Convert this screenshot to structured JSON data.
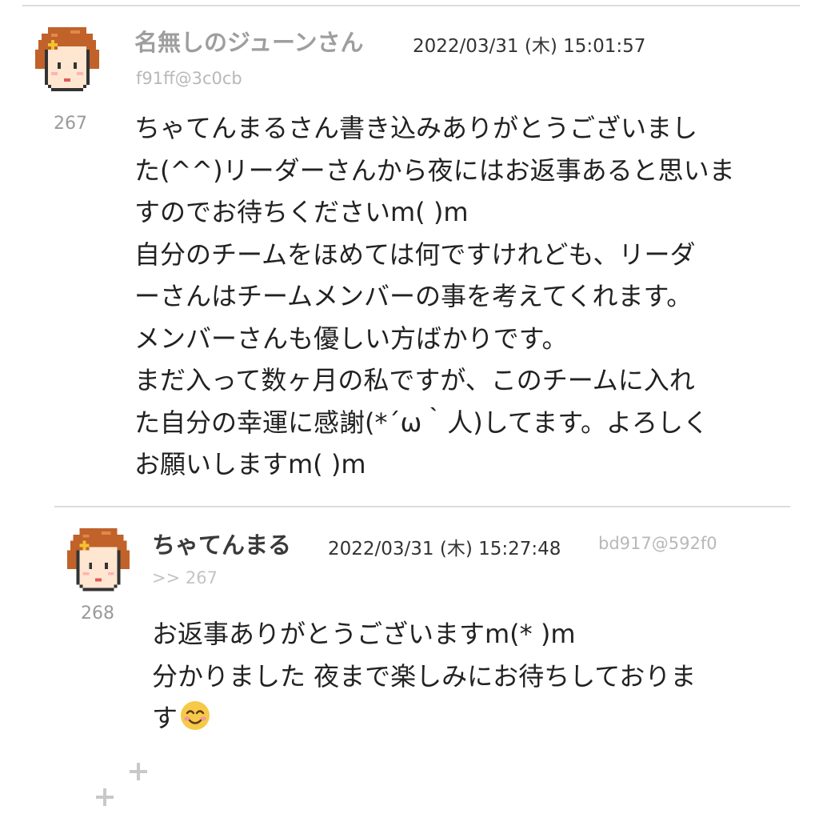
{
  "posts": [
    {
      "number": "267",
      "name": "名無しのジューンさん",
      "date": "2022/03/31 (木) 15:01:57",
      "id": "f91ff@3c0cb",
      "body_lines": [
        "ちゃてんまるさん書き込みありがとうございまし",
        "た(^^)リーダーさんから夜にはお返事あると思いま",
        "すのでお待ちくださいm( )m",
        "自分のチームをほめては何ですけれども、リーダ",
        "ーさんはチームメンバーの事を考えてくれます。",
        "メンバーさんも優しい方ばかりです。",
        "まだ入って数ヶ月の私ですが、このチームに入れ",
        "た自分の幸運に感謝(*´ω｀人)してます。よろしく",
        "お願いしますm( )m"
      ]
    },
    {
      "number": "268",
      "name": "ちゃてんまる",
      "date": "2022/03/31 (木) 15:27:48",
      "id": "bd917@592f0",
      "anchor": ">> 267",
      "body_lines": [
        "お返事ありがとうございますm(* )m",
        "分かりました 夜まで楽しみにお待ちしておりま",
        "す"
      ],
      "emoji": "smiling-face-icon"
    }
  ],
  "colors": {
    "divider": "#dcdcdc",
    "hair": "#c0622a",
    "skin": "#ffe6d0",
    "muted_text": "#9e9e9e"
  }
}
